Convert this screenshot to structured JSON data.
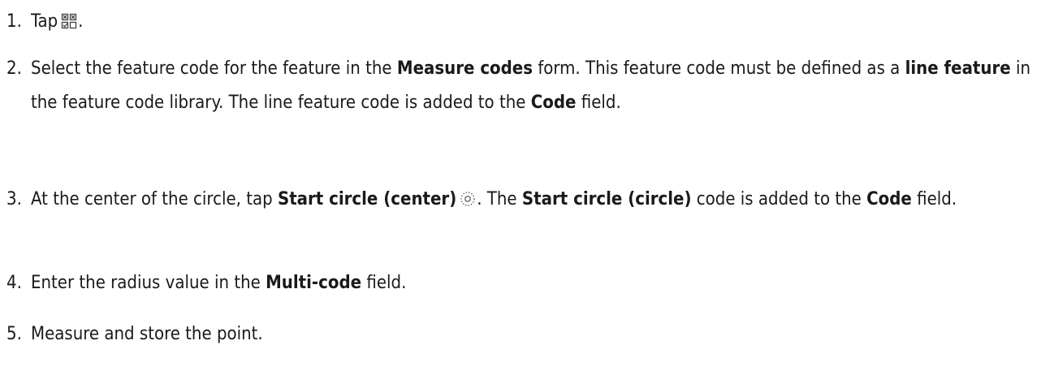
{
  "steps": [
    {
      "number": "1.",
      "pre": "Tap",
      "icon": "measure-codes-icon",
      "post": "."
    },
    {
      "number": "2.",
      "t1": "Select the feature code for the feature in the ",
      "b1": "Measure codes",
      "t2": " form. This feature code must be defined as a ",
      "b2": "line feature",
      "t3": " in the feature code library. The line feature code is added to the ",
      "b3": "Code",
      "t4": " field."
    },
    {
      "number": "3.",
      "t1": "At the center of the circle, tap ",
      "b1": "Start circle (center)",
      "icon": "start-circle-center-icon",
      "t2": ". The ",
      "b2": "Start circle (circle)",
      "t3": " code is added to the ",
      "b3": "Code",
      "t4": " field."
    },
    {
      "number": "4.",
      "t1": "Enter the radius value in the ",
      "b1": "Multi-code",
      "t2": " field."
    },
    {
      "number": "5.",
      "t1": "Measure and store the point."
    }
  ]
}
